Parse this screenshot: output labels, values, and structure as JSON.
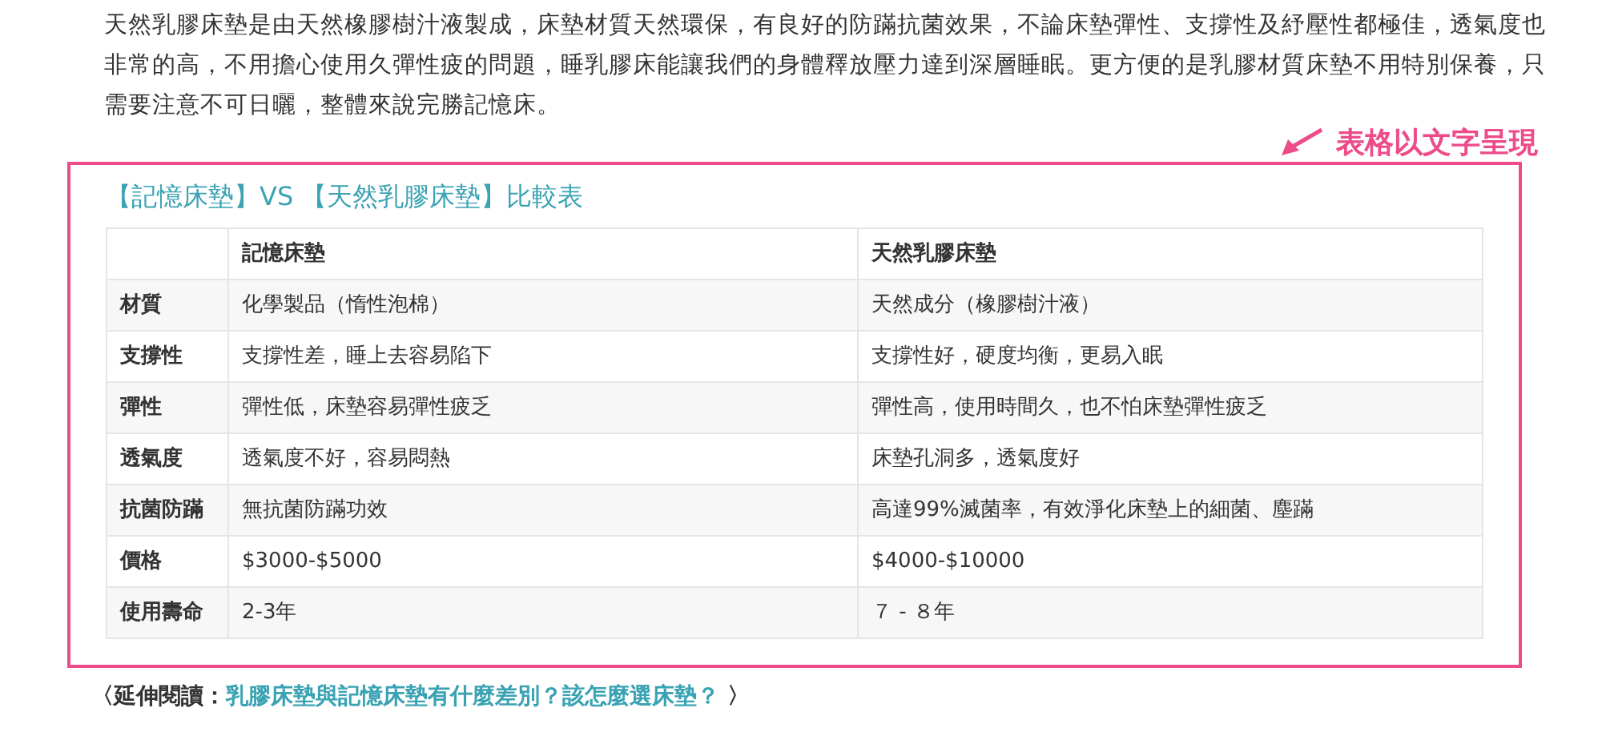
{
  "intro": "天然乳膠床墊是由天然橡膠樹汁液製成，床墊材質天然環保，有良好的防蹣抗菌效果，不論床墊彈性、支撐性及紓壓性都極佳，透氣度也非常的高，不用擔心使用久彈性疲的問題，睡乳膠床能讓我們的身體釋放壓力達到深層睡眠。更方便的是乳膠材質床墊不用特別保養，只需要注意不可日曬，整體來說完勝記憶床。",
  "annotation": "表格以文字呈現",
  "comparison": {
    "title": "【記憶床墊】VS 【天然乳膠床墊】比較表",
    "columns": [
      "記憶床墊",
      "天然乳膠床墊"
    ],
    "rows": [
      {
        "label": "材質",
        "cells": [
          "化學製品（惰性泡棉）",
          "天然成分（橡膠樹汁液）"
        ]
      },
      {
        "label": "支撐性",
        "cells": [
          "支撐性差，睡上去容易陷下",
          "支撐性好，硬度均衡，更易入眠"
        ]
      },
      {
        "label": "彈性",
        "cells": [
          "彈性低，床墊容易彈性疲乏",
          "彈性高，使用時間久，也不怕床墊彈性疲乏"
        ]
      },
      {
        "label": "透氣度",
        "cells": [
          "透氣度不好，容易悶熱",
          "床墊孔洞多，透氣度好"
        ]
      },
      {
        "label": "抗菌防蹣",
        "cells": [
          "無抗菌防蹣功效",
          "高達99%滅菌率，有效淨化床墊上的細菌、塵蹣"
        ]
      },
      {
        "label": "價格",
        "cells": [
          "$3000-$5000",
          "$4000-$10000"
        ]
      },
      {
        "label": "使用壽命",
        "cells": [
          "2-3年",
          "７ - ８年"
        ]
      }
    ]
  },
  "further_reading": {
    "prefix": "〈延伸閱讀：",
    "link": "乳膠床墊與記憶床墊有什麼差別？該怎麼選床墊？",
    "suffix": "〉"
  }
}
